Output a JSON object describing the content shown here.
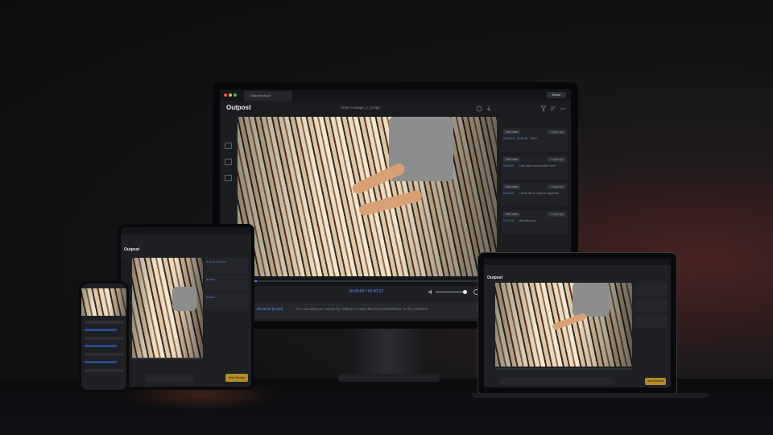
{
  "window": {
    "tab_title": "Outpost.cloud",
    "share_label": "Share"
  },
  "header": {
    "logo": "Outpost",
    "filename": "Crate Footage_2_3.mp4"
  },
  "player": {
    "timecode": "00:00:00 / 00:00:52",
    "comment_stamp": "00:00:00 [Crate]",
    "comment_text": "You can add your review by clicking to insert the current timeframe in the comment"
  },
  "comments": [
    {
      "chip": "Shot note",
      "time": "00:00:18 - 00:00:18",
      "text": "Nice!",
      "tag": "2 days ago"
    },
    {
      "chip": "Shot note",
      "time": "00:00:22",
      "text": "Let's add a sound effect here",
      "tag": "2 days ago"
    },
    {
      "chip": "Shot note",
      "time": "00:00:31",
      "text": "I think this is ready for approval",
      "tag": "2 days ago"
    },
    {
      "chip": "Shot note",
      "time": "00:00:41",
      "text": "Beautiful shot",
      "tag": "2 days ago"
    }
  ],
  "tablet": {
    "logo": "Outpost",
    "cta": "Send Review"
  },
  "laptop": {
    "logo": "Outpost",
    "cta": "Send Review"
  },
  "colors": {
    "accent": "#5c8ef0",
    "cta": "#b58a2a",
    "bg": "#1e2024"
  }
}
